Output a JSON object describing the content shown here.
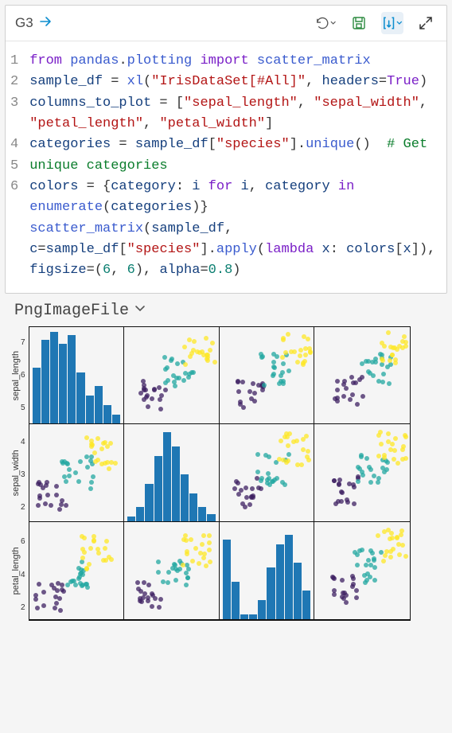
{
  "header": {
    "cell": "G3",
    "icons": {
      "goto": "arrow-right",
      "undo": "undo",
      "save": "save",
      "runtype": "run-brackets",
      "expand": "expand"
    }
  },
  "code": {
    "lines": [
      [
        {
          "t": "from ",
          "c": "kw"
        },
        {
          "t": "pandas",
          "c": "fn"
        },
        {
          "t": ".",
          "c": "op"
        },
        {
          "t": "plotting",
          "c": "fn"
        },
        {
          "t": " ",
          "c": "op"
        },
        {
          "t": "import",
          "c": "kw"
        },
        {
          "t": " scatter_matrix",
          "c": "fn"
        }
      ],
      [
        {
          "t": "sample_df",
          "c": "id"
        },
        {
          "t": " = ",
          "c": "op"
        },
        {
          "t": "xl",
          "c": "fn"
        },
        {
          "t": "(",
          "c": "op"
        },
        {
          "t": "\"IrisDataSet[#All]\"",
          "c": "str"
        },
        {
          "t": ", ",
          "c": "op"
        },
        {
          "t": "headers",
          "c": "id"
        },
        {
          "t": "=",
          "c": "op"
        },
        {
          "t": "True",
          "c": "kw"
        },
        {
          "t": ")",
          "c": "op"
        }
      ],
      [
        {
          "t": "columns_to_plot",
          "c": "id"
        },
        {
          "t": " = [",
          "c": "op"
        },
        {
          "t": "\"sepal_length\"",
          "c": "str"
        },
        {
          "t": ", ",
          "c": "op"
        },
        {
          "t": "\"sepal_width\"",
          "c": "str"
        },
        {
          "t": ", ",
          "c": "op"
        },
        {
          "t": "\"petal_length\"",
          "c": "str"
        },
        {
          "t": ", ",
          "c": "op"
        },
        {
          "t": "\"petal_width\"",
          "c": "str"
        },
        {
          "t": "]",
          "c": "op"
        }
      ],
      [
        {
          "t": "categories",
          "c": "id"
        },
        {
          "t": " = ",
          "c": "op"
        },
        {
          "t": "sample_df",
          "c": "id"
        },
        {
          "t": "[",
          "c": "op"
        },
        {
          "t": "\"species\"",
          "c": "str"
        },
        {
          "t": "].",
          "c": "op"
        },
        {
          "t": "unique",
          "c": "fn"
        },
        {
          "t": "()  ",
          "c": "op"
        },
        {
          "t": "# Get unique categories",
          "c": "cm"
        }
      ],
      [
        {
          "t": "colors",
          "c": "id"
        },
        {
          "t": " = {",
          "c": "op"
        },
        {
          "t": "category",
          "c": "id"
        },
        {
          "t": ": ",
          "c": "op"
        },
        {
          "t": "i",
          "c": "id"
        },
        {
          "t": " ",
          "c": "op"
        },
        {
          "t": "for",
          "c": "kw"
        },
        {
          "t": " ",
          "c": "op"
        },
        {
          "t": "i",
          "c": "id"
        },
        {
          "t": ", ",
          "c": "op"
        },
        {
          "t": "category",
          "c": "id"
        },
        {
          "t": " ",
          "c": "op"
        },
        {
          "t": "in",
          "c": "kw"
        },
        {
          "t": " ",
          "c": "op"
        },
        {
          "t": "enumerate",
          "c": "fn"
        },
        {
          "t": "(",
          "c": "op"
        },
        {
          "t": "categories",
          "c": "id"
        },
        {
          "t": ")}",
          "c": "op"
        }
      ],
      [
        {
          "t": "scatter_matrix",
          "c": "fn"
        },
        {
          "t": "(",
          "c": "op"
        },
        {
          "t": "sample_df",
          "c": "id"
        },
        {
          "t": ", ",
          "c": "op"
        },
        {
          "t": "c",
          "c": "id"
        },
        {
          "t": "=",
          "c": "op"
        },
        {
          "t": "sample_df",
          "c": "id"
        },
        {
          "t": "[",
          "c": "op"
        },
        {
          "t": "\"species\"",
          "c": "str"
        },
        {
          "t": "].",
          "c": "op"
        },
        {
          "t": "apply",
          "c": "fn"
        },
        {
          "t": "(",
          "c": "op"
        },
        {
          "t": "lambda",
          "c": "kw"
        },
        {
          "t": " ",
          "c": "op"
        },
        {
          "t": "x",
          "c": "id"
        },
        {
          "t": ": ",
          "c": "op"
        },
        {
          "t": "colors",
          "c": "id"
        },
        {
          "t": "[",
          "c": "op"
        },
        {
          "t": "x",
          "c": "id"
        },
        {
          "t": "]), ",
          "c": "op"
        },
        {
          "t": "figsize",
          "c": "id"
        },
        {
          "t": "=(",
          "c": "op"
        },
        {
          "t": "6",
          "c": "num"
        },
        {
          "t": ", ",
          "c": "op"
        },
        {
          "t": "6",
          "c": "num"
        },
        {
          "t": "), ",
          "c": "op"
        },
        {
          "t": "alpha",
          "c": "id"
        },
        {
          "t": "=",
          "c": "op"
        },
        {
          "t": "0.8",
          "c": "num"
        },
        {
          "t": ")",
          "c": "op"
        }
      ]
    ]
  },
  "output": {
    "title": "PngImageFile"
  },
  "chart_data": {
    "type": "scatter_matrix",
    "vars": [
      "sepal_length",
      "sepal_width",
      "petal_length",
      "petal_width"
    ],
    "visible_rows": [
      "sepal_length",
      "sepal_width",
      "petal_length"
    ],
    "y_ticks": {
      "sepal_length": [
        5,
        6,
        7
      ],
      "sepal_width": [
        2,
        3,
        4
      ],
      "petal_length": [
        2,
        4,
        6
      ]
    },
    "category_colors": {
      "setosa": "#3d2062",
      "versicolor": "#22a7a0",
      "virginica": "#fde725"
    },
    "diagonal": "hist",
    "hist_bins": {
      "sepal_length": [
        60,
        90,
        98,
        85,
        95,
        55,
        30,
        40,
        20,
        10
      ],
      "sepal_width": [
        5,
        15,
        40,
        70,
        95,
        80,
        50,
        30,
        15,
        8
      ],
      "petal_length": [
        85,
        40,
        5,
        5,
        20,
        55,
        80,
        90,
        60,
        30
      ]
    },
    "figsize": [
      6,
      6
    ],
    "alpha": 0.8
  }
}
